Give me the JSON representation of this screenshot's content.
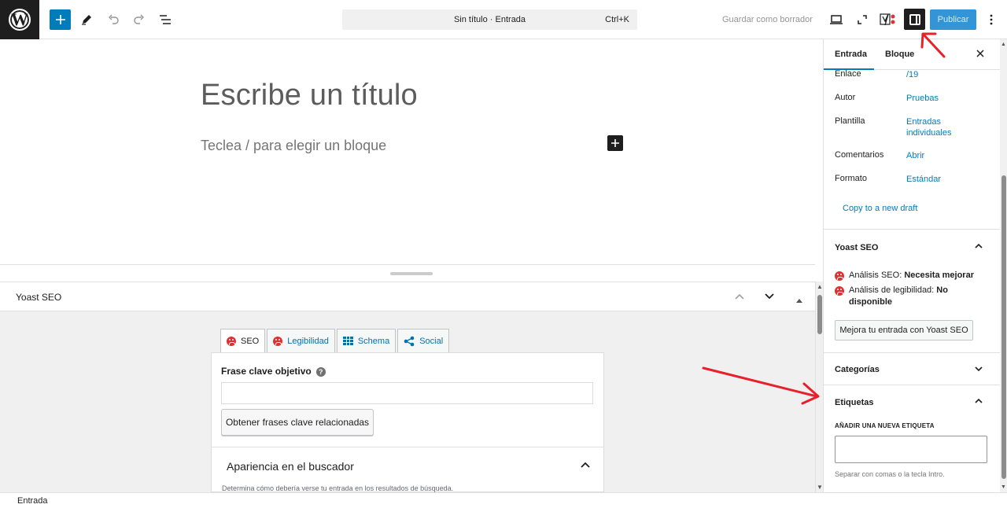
{
  "topbar": {
    "command_title": "Sin título · Entrada",
    "command_shortcut": "Ctrl+K",
    "save_draft": "Guardar como borrador",
    "publish": "Publicar"
  },
  "editor": {
    "title_placeholder": "Escribe un título",
    "block_placeholder": "Teclea / para elegir un bloque"
  },
  "metabox": {
    "title": "Yoast SEO",
    "tabs": [
      {
        "label": "SEO"
      },
      {
        "label": "Legibilidad"
      },
      {
        "label": "Schema"
      },
      {
        "label": "Social"
      }
    ],
    "keyphrase_label": "Frase clave objetivo",
    "help_glyph": "?",
    "related_button": "Obtener frases clave relacionadas",
    "search_appearance": "Apariencia en el buscador",
    "search_appearance_desc": "Determina cómo debería verse tu entrada en los resultados de búsqueda."
  },
  "sidebar": {
    "tabs": [
      {
        "label": "Entrada"
      },
      {
        "label": "Bloque"
      }
    ],
    "summary": [
      {
        "key": "Enlace",
        "value": "/19"
      },
      {
        "key": "Autor",
        "value": "Pruebas"
      },
      {
        "key": "Plantilla",
        "value": "Entradas individuales"
      },
      {
        "key": "Comentarios",
        "value": "Abrir"
      },
      {
        "key": "Formato",
        "value": "Estándar"
      }
    ],
    "copy_draft": "Copy to a new draft",
    "yoast": {
      "title": "Yoast SEO",
      "seo_label": "Análisis SEO:",
      "seo_value": "Necesita mejorar",
      "read_label": "Análisis de legibilidad:",
      "read_value": "No disponible",
      "improve_button": "Mejora tu entrada con Yoast SEO"
    },
    "categories": "Categorías",
    "tags": {
      "title": "Etiquetas",
      "add_label": "AÑADIR UNA NUEVA ETIQUETA",
      "help": "Separar con comas o la tecla Intro."
    }
  },
  "statusbar": {
    "breadcrumb": "Entrada"
  },
  "colors": {
    "accent": "#007cba",
    "error": "#dc3232",
    "annotation": "#e8202a"
  },
  "icons": {
    "wp_letter": "W"
  }
}
